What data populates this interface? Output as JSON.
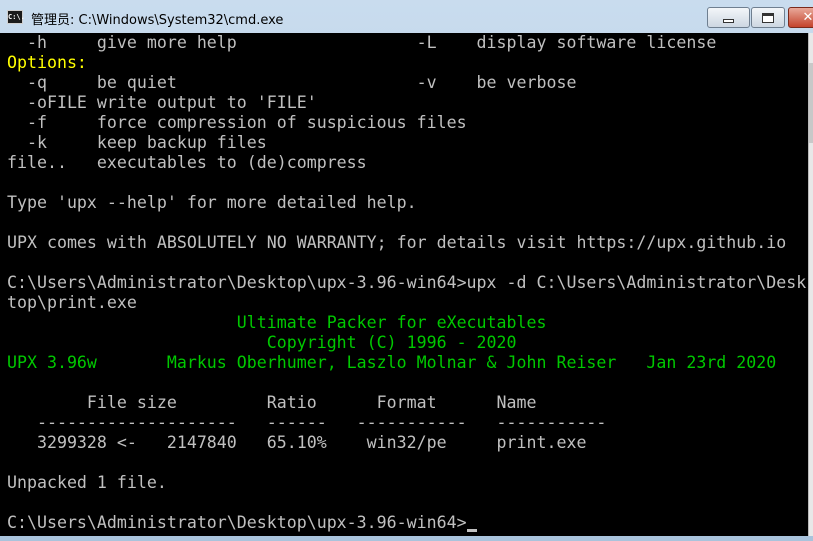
{
  "window": {
    "icon_text": "C:\\.",
    "title": "管理员: C:\\Windows\\System32\\cmd.exe",
    "controls": {
      "minimize": "minimize",
      "maximize": "maximize",
      "close": "✕"
    }
  },
  "console": {
    "lines": [
      {
        "text": "  -h     give more help                  -L    display software license",
        "color": "gray"
      },
      {
        "text": "Options:",
        "color": "yellow"
      },
      {
        "text": "  -q     be quiet                        -v    be verbose",
        "color": "gray"
      },
      {
        "text": "  -oFILE write output to 'FILE'",
        "color": "gray"
      },
      {
        "text": "  -f     force compression of suspicious files",
        "color": "gray"
      },
      {
        "text": "  -k     keep backup files",
        "color": "gray"
      },
      {
        "text": "file..   executables to (de)compress",
        "color": "gray"
      },
      {
        "text": "",
        "color": "gray"
      },
      {
        "text": "Type 'upx --help' for more detailed help.",
        "color": "gray"
      },
      {
        "text": "",
        "color": "gray"
      },
      {
        "text": "UPX comes with ABSOLUTELY NO WARRANTY; for details visit https://upx.github.io",
        "color": "gray"
      },
      {
        "text": "",
        "color": "gray"
      },
      {
        "text": "C:\\Users\\Administrator\\Desktop\\upx-3.96-win64>upx -d C:\\Users\\Administrator\\Desk",
        "color": "gray"
      },
      {
        "text": "top\\print.exe",
        "color": "gray"
      },
      {
        "text": "                       Ultimate Packer for eXecutables",
        "color": "green"
      },
      {
        "text": "                          Copyright (C) 1996 - 2020",
        "color": "green"
      },
      {
        "text": "UPX 3.96w       Markus Oberhumer, Laszlo Molnar & John Reiser   Jan 23rd 2020",
        "color": "green"
      },
      {
        "text": "",
        "color": "gray"
      },
      {
        "text": "        File size         Ratio      Format      Name",
        "color": "gray"
      },
      {
        "text": "   --------------------   ------   -----------   -----------",
        "color": "gray"
      },
      {
        "text": "   3299328 <-   2147840   65.10%    win32/pe     print.exe",
        "color": "gray"
      },
      {
        "text": "",
        "color": "gray"
      },
      {
        "text": "Unpacked 1 file.",
        "color": "gray"
      },
      {
        "text": "",
        "color": "gray"
      }
    ],
    "prompt": "C:\\Users\\Administrator\\Desktop\\upx-3.96-win64>"
  },
  "colors": {
    "background": "#000000",
    "text": "#c0c0c0",
    "yellow": "#ffff00",
    "green": "#00c800"
  }
}
